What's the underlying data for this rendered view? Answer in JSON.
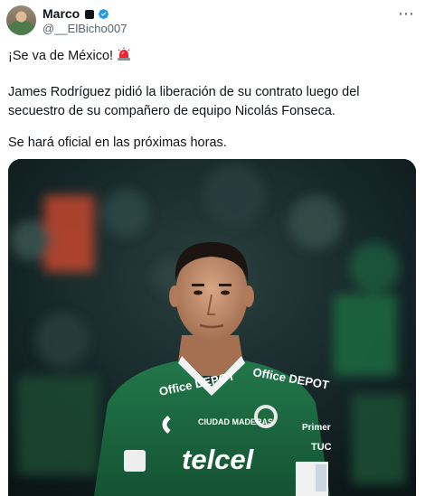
{
  "author": {
    "display_name": "Marco",
    "handle": "@__ElBicho007"
  },
  "tweet": {
    "line1": "¡Se va de México!",
    "line2": "James Rodríguez pidió la liberación de su contrato luego del secuestro de su compañero de equipo Nicolás Fonseca.",
    "line3": "Se hará oficial en las próximas horas."
  },
  "photo": {
    "jersey_text": {
      "sponsor_main": "telcel",
      "sponsor_left": "Office DEPOT",
      "sponsor_right": "Office DEPOT",
      "sponsor_center": "CIUDAD MADERAS",
      "sponsor_side": "Primer",
      "sponsor_side2": "TUC"
    }
  },
  "colors": {
    "accent_blue": "#1d9bf0",
    "siren_red": "#f4212e",
    "jersey_green": "#1d6b3f"
  },
  "icons": [
    "avatar",
    "square-badge-icon",
    "verified-icon",
    "more-icon",
    "siren-icon"
  ]
}
